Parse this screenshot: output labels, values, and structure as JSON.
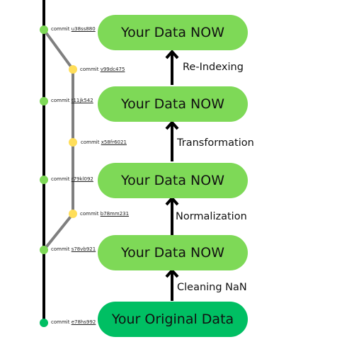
{
  "colors": {
    "main_line": "#000000",
    "branch_line": "#7f7f7f",
    "main_commit": "#7ed957",
    "branch_commit": "#ffde59",
    "root_commit": "#00bf63",
    "box_now": "#7ed957",
    "box_original": "#00bf63"
  },
  "commits": {
    "main": [
      {
        "prefix": "commit",
        "hash": "u38ss880"
      },
      {
        "prefix": "commit",
        "hash": "t11jk542"
      },
      {
        "prefix": "commit",
        "hash": "r79kl092"
      },
      {
        "prefix": "commit",
        "hash": "s78vb921"
      },
      {
        "prefix": "commit",
        "hash": "e78hs992"
      }
    ],
    "branch": [
      {
        "prefix": "commit",
        "hash": "v99dc475"
      },
      {
        "prefix": "commit",
        "hash": "x58fr6021"
      },
      {
        "prefix": "commit",
        "hash": "b78mm231"
      }
    ]
  },
  "boxes": [
    {
      "label": "Your Data NOW"
    },
    {
      "label": "Your Data NOW"
    },
    {
      "label": "Your Data NOW"
    },
    {
      "label": "Your Data NOW"
    },
    {
      "label": "Your Original Data"
    }
  ],
  "steps": [
    {
      "label": "Re-Indexing"
    },
    {
      "label": "Transformation"
    },
    {
      "label": "Normalization"
    },
    {
      "label": "Cleaning NaN"
    }
  ]
}
